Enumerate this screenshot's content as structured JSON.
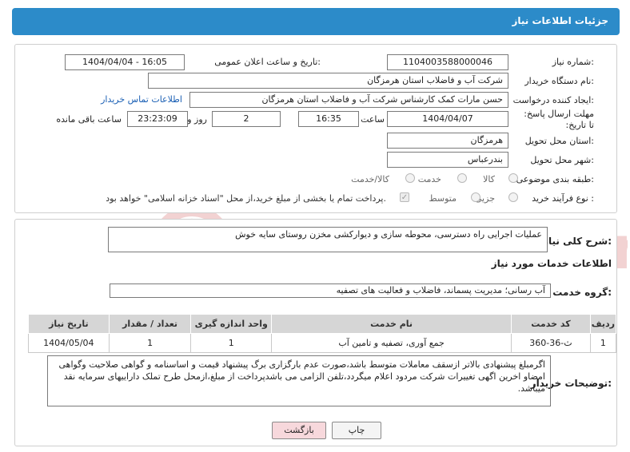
{
  "header": {
    "title": "جزئیات اطلاعات نیاز"
  },
  "form": {
    "need_number_label": "شماره نیاز:",
    "need_number": "1104003588000046",
    "announce_label": "تاریخ و ساعت اعلان عمومی:",
    "announce_value": "1404/04/04 - 16:05",
    "buyer_label": "نام دستگاه خریدار:",
    "buyer_value": "شرکت آب و فاضلاب استان هرمزگان",
    "creator_label": "ایجاد کننده درخواست:",
    "creator_value": "حسن مارات کمک کارشناس شرکت آب و فاضلاب استان هرمزگان",
    "contact_link": "اطلاعات تماس خریدار",
    "deadline_label": "مهلت ارسال پاسخ: تا تاریخ:",
    "deadline_date": "1404/04/07",
    "time_label": "ساعت",
    "deadline_time": "16:35",
    "days_value": "2",
    "days_label": "روز و",
    "remaining_time": "23:23:09",
    "remaining_label": "ساعت باقی مانده",
    "province_label": "استان محل تحویل:",
    "province_value": "هرمزگان",
    "city_label": "شهر محل تحویل:",
    "city_value": "بندرعباس",
    "category_label": "طبقه بندی موضوعی:",
    "category_options": [
      "کالا",
      "خدمت",
      "کالا/خدمت"
    ],
    "process_label": "نوع فرآیند خرید :",
    "process_options": [
      "جزیی",
      "متوسط"
    ],
    "payment_note": "پرداخت تمام یا بخشی از مبلغ خرید،از محل \"اسناد خزانه اسلامی\" خواهد بود."
  },
  "details": {
    "summary_label": "شرح کلی نیاز:",
    "summary_value": "عملیات اجرایی راه دسترسی، محوطه سازی و دیوارکشی مخزن روستای سایه خوش",
    "services_title": "اطلاعات خدمات مورد نیاز",
    "group_label": "گروه خدمت:",
    "group_value": "آب رسانی؛ مدیریت پسماند، فاضلاب و فعالیت های تصفیه",
    "table": {
      "headers": [
        "ردیف",
        "کد خدمت",
        "نام خدمت",
        "واحد اندازه گیری",
        "تعداد / مقدار",
        "تاریخ نیاز"
      ],
      "rows": [
        [
          "1",
          "ث-36-360",
          "جمع آوری، تصفیه و تامین آب",
          "1",
          "1",
          "1404/05/04"
        ]
      ]
    },
    "notes_label": "توضیحات خریدار:",
    "notes_value": "اگرمبلغ پیشنهادی بالاتر ازسقف معاملات متوسط باشد،صورت عدم بارگزاری برگ پیشنهاد قیمت و اساسنامه و گواهی صلاحیت وگواهی امضاو اخرین اگهی تغییرات شرکت مردود اعلام میگردد،تلفن الزامی می باشدپرداخت از مبلغ،ازمحل طرح تملک داراییهای سرمایه نقد میباشد."
  },
  "buttons": {
    "print": "چاپ",
    "back": "بازگشت"
  },
  "watermark": {
    "text": "AriaTender.net"
  },
  "colors": {
    "header_bg": "#2c8bc9",
    "link": "#1a5fb4",
    "back_button_bg": "#f7d8dc",
    "watermark": "#f2d2d2"
  },
  "icons": {
    "checkbox": "check-icon",
    "radio": "radio-icon",
    "watermark": "aria-tender-logo"
  }
}
